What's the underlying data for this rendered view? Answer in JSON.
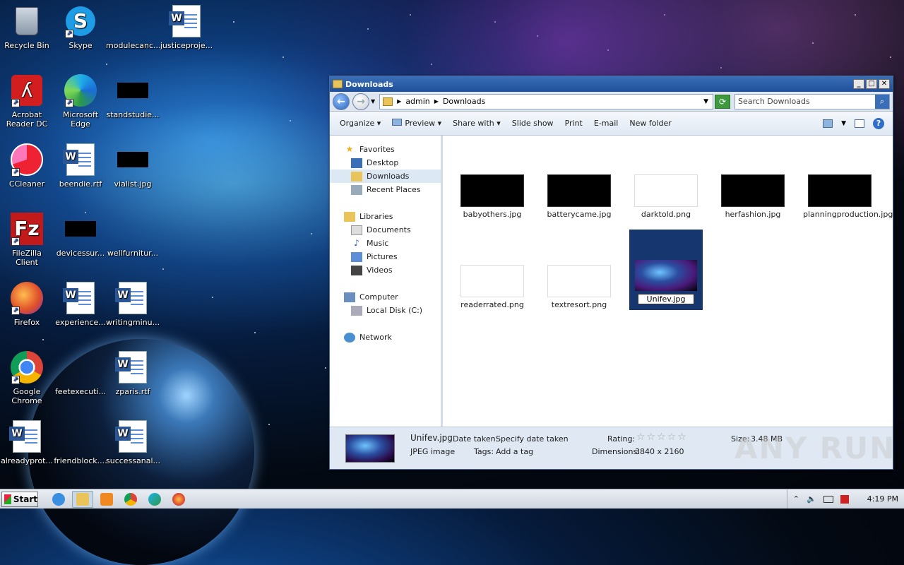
{
  "desktop_icons": [
    {
      "label": "Recycle Bin",
      "icon": "recycle-bin-icon"
    },
    {
      "label": "Skype",
      "icon": "skype-icon"
    },
    {
      "label": "modulecanc...",
      "icon": "blank-file-icon"
    },
    {
      "label": "justiceproje...",
      "icon": "word-doc-icon"
    },
    {
      "label": "Acrobat Reader DC",
      "icon": "acrobat-icon"
    },
    {
      "label": "Microsoft Edge",
      "icon": "edge-icon"
    },
    {
      "label": "standstudie...",
      "icon": "black-image-icon"
    },
    {
      "label": "CCleaner",
      "icon": "ccleaner-icon"
    },
    {
      "label": "beendie.rtf",
      "icon": "word-doc-icon"
    },
    {
      "label": "vialist.jpg",
      "icon": "black-image-icon"
    },
    {
      "label": "FileZilla Client",
      "icon": "filezilla-icon"
    },
    {
      "label": "devicessur...",
      "icon": "black-image-icon"
    },
    {
      "label": "wellfurnitur...",
      "icon": "blank-file-icon"
    },
    {
      "label": "Firefox",
      "icon": "firefox-icon"
    },
    {
      "label": "experience...",
      "icon": "word-doc-icon"
    },
    {
      "label": "writingminu...",
      "icon": "word-doc-icon"
    },
    {
      "label": "Google Chrome",
      "icon": "chrome-icon"
    },
    {
      "label": "feetexecuti...",
      "icon": "blank-file-icon"
    },
    {
      "label": "zparis.rtf",
      "icon": "word-doc-icon"
    },
    {
      "label": "alreadyprot...",
      "icon": "word-doc-icon"
    },
    {
      "label": "friendblock....",
      "icon": "blank-file-icon"
    },
    {
      "label": "successanal...",
      "icon": "word-doc-icon"
    }
  ],
  "window": {
    "title": "Downloads",
    "breadcrumb": [
      "admin",
      "Downloads"
    ],
    "search_placeholder": "Search Downloads",
    "toolbar": {
      "organize": "Organize",
      "preview": "Preview",
      "share": "Share with",
      "slideshow": "Slide show",
      "print": "Print",
      "email": "E-mail",
      "newfolder": "New folder"
    },
    "nav": {
      "favorites": "Favorites",
      "desktop": "Desktop",
      "downloads": "Downloads",
      "recent": "Recent Places",
      "libraries": "Libraries",
      "documents": "Documents",
      "music": "Music",
      "pictures": "Pictures",
      "videos": "Videos",
      "computer": "Computer",
      "localdisk": "Local Disk (C:)",
      "network": "Network"
    },
    "files": [
      {
        "name": "babyothers.jpg",
        "thumb": "dark"
      },
      {
        "name": "batterycame.jpg",
        "thumb": "dark"
      },
      {
        "name": "darktold.png",
        "thumb": "light"
      },
      {
        "name": "herfashion.jpg",
        "thumb": "dark"
      },
      {
        "name": "planningproduction.jpg",
        "thumb": "dark"
      },
      {
        "name": "readerrated.png",
        "thumb": "light"
      },
      {
        "name": "textresort.png",
        "thumb": "light"
      },
      {
        "name": "Unifev.jpg",
        "thumb": "space",
        "selected": true
      }
    ],
    "details": {
      "name": "Unifev.jpg",
      "type": "JPEG image",
      "date_label": "Date taken:",
      "date_value": "Specify date taken",
      "tags_label": "Tags:",
      "tags_value": "Add a tag",
      "rating_label": "Rating:",
      "rating_value": 0,
      "dims_label": "Dimensions:",
      "dims_value": "3840 x 2160",
      "size_label": "Size:",
      "size_value": "3.48 MB"
    }
  },
  "taskbar": {
    "start": "Start",
    "time": "4:19 PM"
  },
  "watermark": "ANY RUN"
}
